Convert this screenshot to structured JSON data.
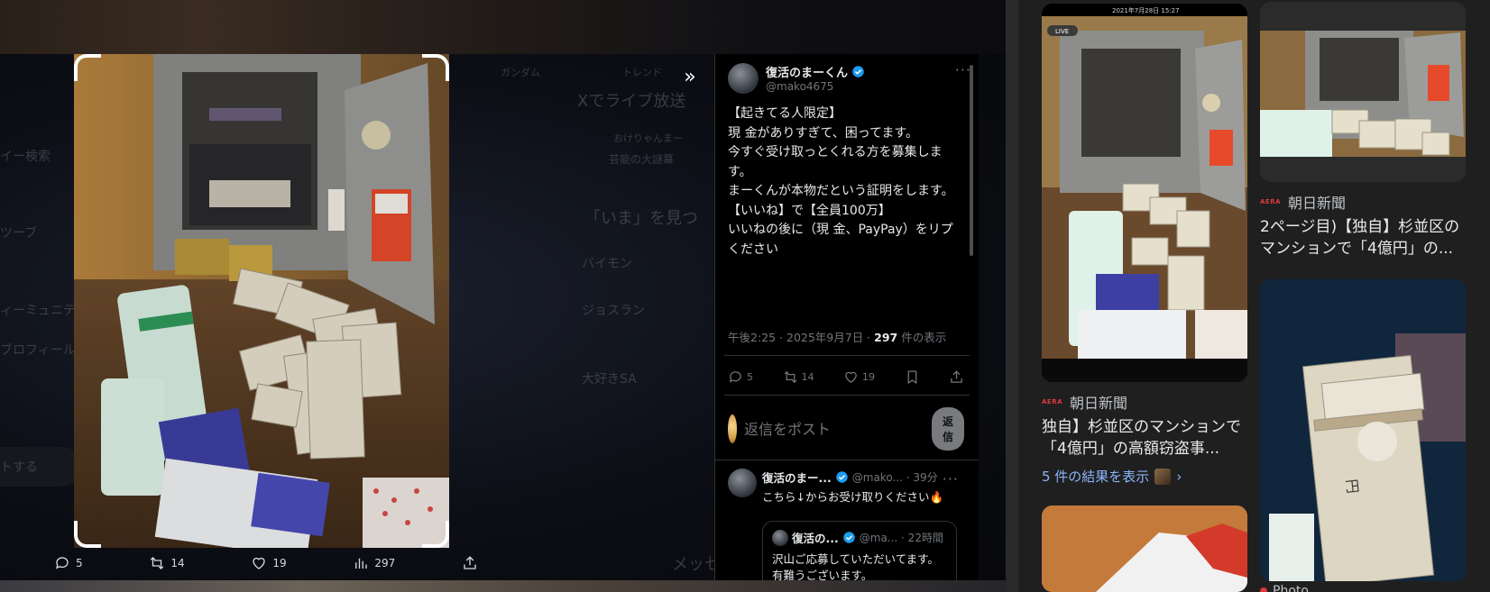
{
  "viewer": {
    "ghost_texts": [
      "Xでライブ放送",
      "「いま」を見つ",
      "バイモン",
      "ジョスラン",
      "大好きSA",
      "メッセ",
      "ガンダム",
      "トレンド",
      "おけりゃんまー",
      "芸能の大謎幕",
      "イー検索",
      "ツーブ",
      "ィーミュニティ",
      "ブロフィール",
      "トする"
    ],
    "expand_icon": "double-chevron-right-icon",
    "media_actions": {
      "replies": "5",
      "reposts": "14",
      "likes": "19",
      "views": "297"
    }
  },
  "tweet": {
    "author_name": "復活のまーくん",
    "author_handle": "@mako4675",
    "more": "···",
    "lines": [
      "【起きてる人限定】",
      "現 金がありすぎて、困ってます。",
      "",
      "今すぐ受け取っとくれる方を募集します。",
      "まーくんが本物だという証明をします。",
      "",
      "【いいね】で【全員100万】",
      "いいねの後に（現 金、PayPay）をリプください"
    ],
    "meta_time": "午後2:25 · 2025年9月7日 · ",
    "meta_views": "297",
    "meta_views_suffix": " 件の表示",
    "stats": {
      "replies": "5",
      "reposts": "14",
      "likes": "19"
    },
    "reply_placeholder": "返信をポスト",
    "reply_button": "返信",
    "reply": {
      "name": "復活のまー...",
      "handle_time": "@mako... · 39分",
      "body": "こちら↓からお受け取りください🔥",
      "quote": {
        "name": "復活の...",
        "handle_time": "@ma... · 22時間",
        "body": "沢山ご応募していただいてます。\n有難うございます。"
      }
    }
  },
  "results": {
    "badge_t1_date": "2021年7月28日 15:27",
    "badge_live": "LIVE",
    "item1": {
      "source_logo": "AERA",
      "source": "朝日新聞",
      "title": "独自】杉並区のマンションで「4億円」の高額窃盗事...",
      "more_link": "5 件の結果を表示"
    },
    "item2": {
      "source_logo": "AERA",
      "source": "朝日新聞",
      "title": "2ページ目)【独自】杉並区のマンションで「4億円」の..."
    },
    "item4_source": "Photo ..."
  },
  "colors": {
    "accent_blue": "#1d9bf0",
    "link_blue": "#8ab4f8",
    "muted": "#71767b",
    "aera_red": "#e03b3b"
  }
}
